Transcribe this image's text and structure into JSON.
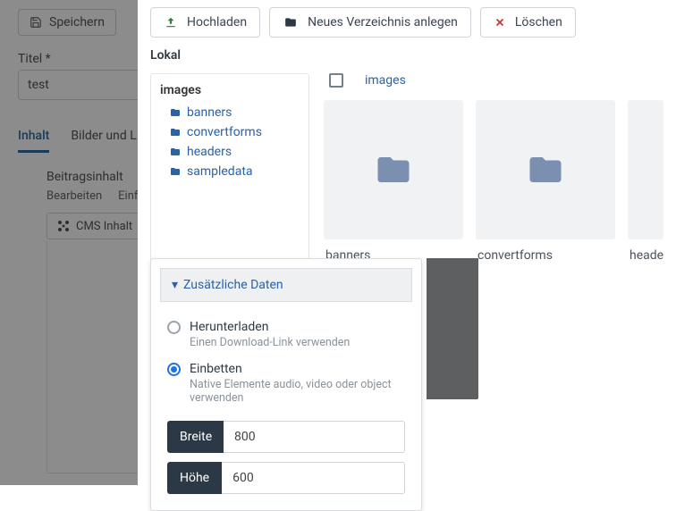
{
  "editor": {
    "save_label": "Speichern",
    "title_label": "Titel *",
    "title_value": "test",
    "tabs": [
      "Inhalt",
      "Bilder und L"
    ],
    "section_label": "Beitragsinhalt",
    "toolbar": [
      "Bearbeiten",
      "Einfüg"
    ],
    "cms_button": "CMS Inhalt"
  },
  "media": {
    "upload_label": "Hochladen",
    "newdir_label": "Neues Verzeichnis anlegen",
    "delete_label": "Löschen",
    "local_label": "Lokal",
    "tree": {
      "root": "images",
      "items": [
        "banners",
        "convertforms",
        "headers",
        "sampledata"
      ]
    },
    "breadcrumb": "images",
    "folders": [
      "banners",
      "convertforms",
      "headers"
    ]
  },
  "popover": {
    "header": "Zusätzliche Daten",
    "options": [
      {
        "label": "Herunterladen",
        "desc": "Einen Download-Link verwenden",
        "selected": false
      },
      {
        "label": "Einbetten",
        "desc": "Native Elemente audio, video oder object verwenden",
        "selected": true
      }
    ],
    "width_label": "Breite",
    "width_value": "800",
    "height_label": "Höhe",
    "height_value": "600"
  }
}
